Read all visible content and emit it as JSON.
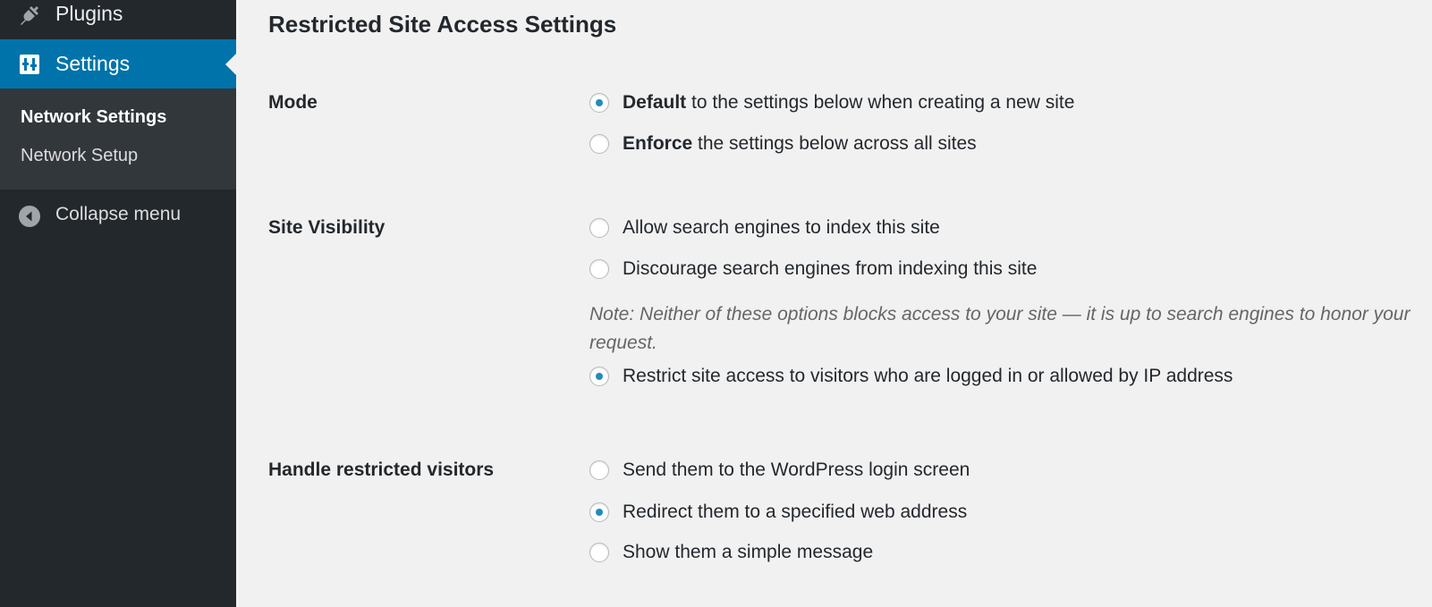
{
  "sidebar": {
    "plugins_label": "Plugins",
    "settings_label": "Settings",
    "submenu": {
      "network_settings": "Network Settings",
      "network_setup": "Network Setup"
    },
    "collapse_label": "Collapse menu",
    "active_color": "#0073aa",
    "bg_color": "#23282d"
  },
  "page": {
    "title": "Restricted Site Access Settings"
  },
  "mode": {
    "label": "Mode",
    "options": [
      {
        "bold": "Default",
        "rest": " to the settings below when creating a new site",
        "checked": true
      },
      {
        "bold": "Enforce",
        "rest": " the settings below across all sites",
        "checked": false
      }
    ]
  },
  "visibility": {
    "label": "Site Visibility",
    "options": [
      {
        "text": "Allow search engines to index this site",
        "checked": false
      },
      {
        "text": "Discourage search engines from indexing this site",
        "checked": false
      },
      {
        "text": "Restrict site access to visitors who are logged in or allowed by IP address",
        "checked": true
      }
    ],
    "note": "Note: Neither of these options blocks access to your site — it is up to search engines to honor your request."
  },
  "restricted": {
    "label": "Handle restricted visitors",
    "options": [
      {
        "text": "Send them to the WordPress login screen",
        "checked": false
      },
      {
        "text": "Redirect them to a specified web address",
        "checked": true
      },
      {
        "text": "Show them a simple message",
        "checked": false
      }
    ]
  },
  "icons": {
    "plugins": "plugin-icon",
    "settings": "settings-icon",
    "collapse": "collapse-icon"
  }
}
